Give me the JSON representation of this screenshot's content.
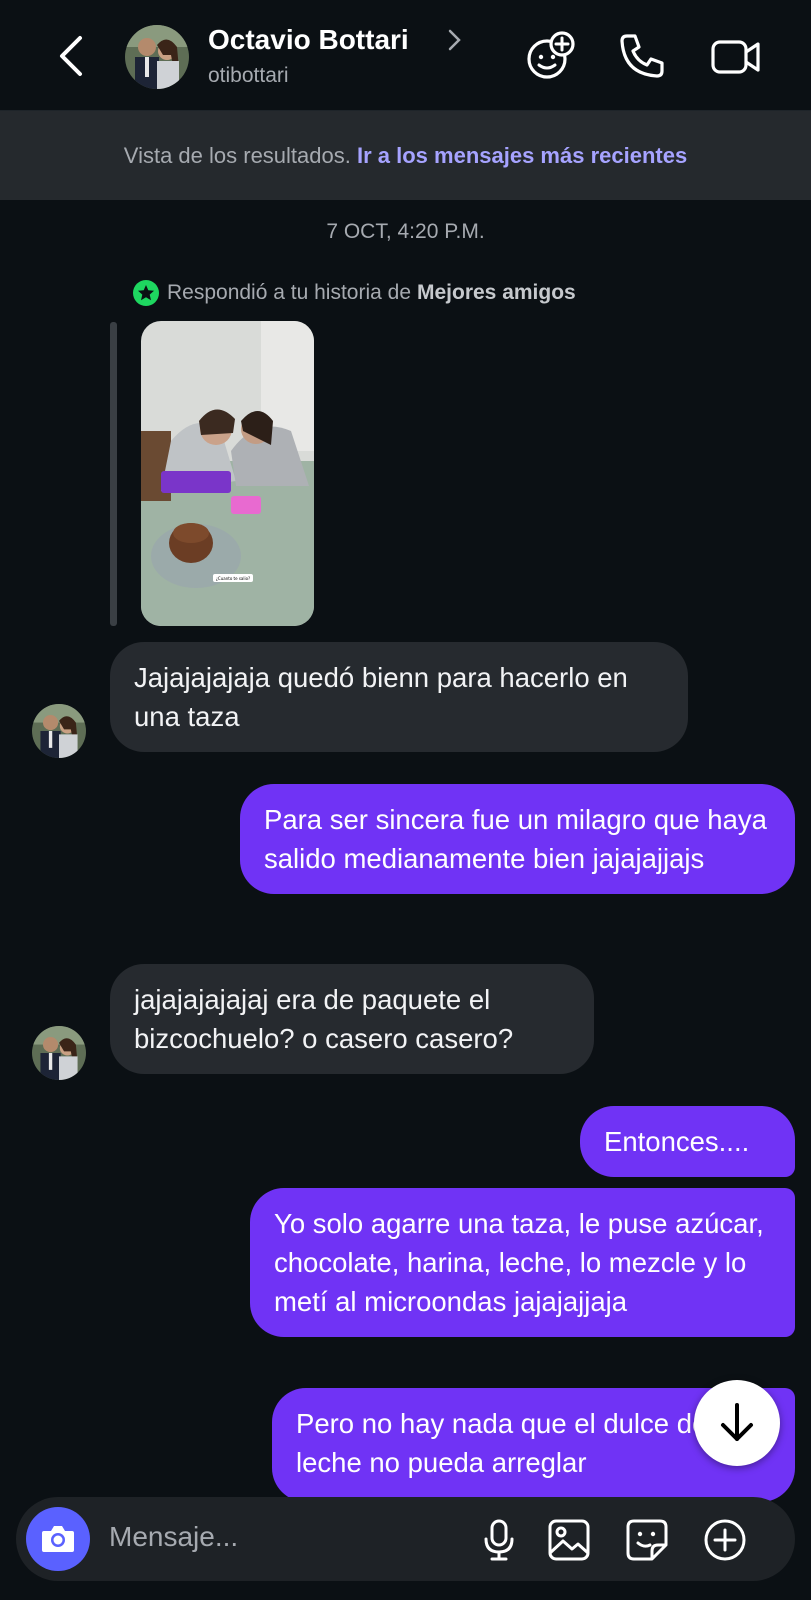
{
  "header": {
    "contact_name": "Octavio Bottari",
    "username": "otibottari",
    "icons": [
      "back-icon",
      "add-sticker-effect-icon",
      "phone-icon",
      "video-camera-icon"
    ]
  },
  "search_banner": {
    "text": "Vista de los resultados.",
    "link": "Ir a los mensajes más recientes"
  },
  "conversation": {
    "date": "7 OCT, 4:20 P.M.",
    "story_reply": {
      "prefix": "Respondió a tu historia de",
      "list_name": "Mejores amigos",
      "sticker_text": "¿Cuanto te salio?"
    },
    "messages": [
      {
        "sender": "them",
        "text": "Jajajajajaja quedó bienn para hacerlo en una taza"
      },
      {
        "sender": "me",
        "text": "Para ser sincera fue un milagro que haya salido medianamente bien jajajajjajs"
      },
      {
        "sender": "them",
        "text": "jajajajajajaj era de paquete el bizcochuelo? o casero casero?"
      },
      {
        "sender": "me",
        "text": "Entonces...."
      },
      {
        "sender": "me",
        "text": "Yo solo agarre una taza, le puse azúcar, chocolate, harina, leche, lo mezcle y lo metí al microondas jajajajjaja"
      },
      {
        "sender": "me",
        "text": "Pero no hay nada que el dulce de leche no pueda arreglar"
      }
    ]
  },
  "composer": {
    "placeholder": "Mensaje...",
    "icons": [
      "camera-icon",
      "microphone-icon",
      "gallery-icon",
      "sticker-icon",
      "plus-icon"
    ]
  },
  "colors": {
    "background": "#0b1014",
    "incoming_bubble": "#262a2f",
    "outgoing_bubble": "#7033f5",
    "link": "#a6a3ff",
    "camera_button": "#5a61ff",
    "close_friends_star": "#1ed760"
  }
}
